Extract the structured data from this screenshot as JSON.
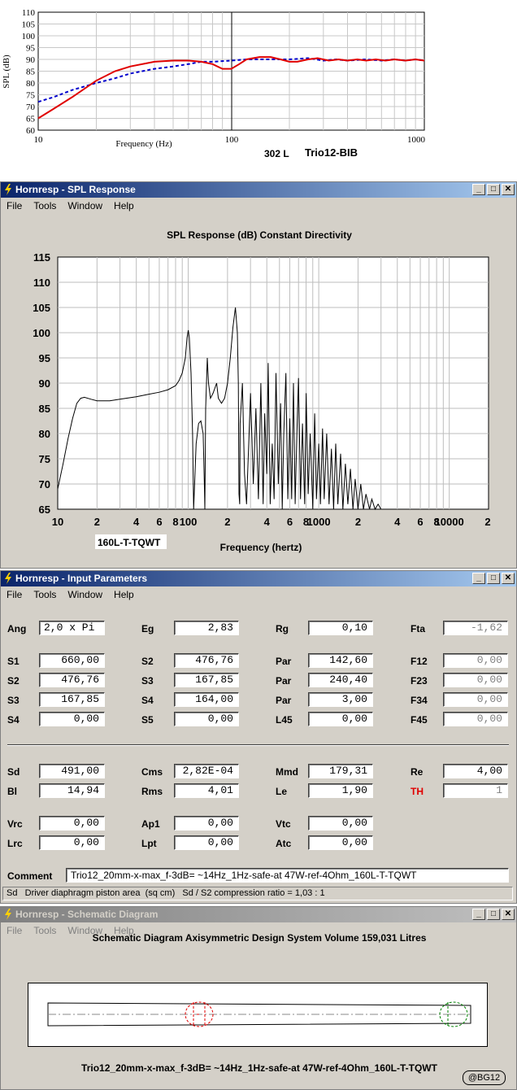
{
  "top_chart": {
    "ylabel": "SPL (dB)",
    "xlabel": "Frequency (Hz)",
    "y_ticks": [
      "110",
      "105",
      "100",
      "95",
      "90",
      "85",
      "80",
      "75",
      "70",
      "65",
      "60"
    ],
    "x_ticks": [
      "10",
      "100",
      "1000"
    ],
    "volume": "302 L",
    "name": "Trio12-BIB"
  },
  "spl_window": {
    "title": "Hornresp - SPL Response",
    "menu": [
      "File",
      "Tools",
      "Window",
      "Help"
    ],
    "heading": "SPL Response (dB)   Constant Directivity",
    "y_ticks": [
      "115",
      "110",
      "105",
      "100",
      "95",
      "90",
      "85",
      "80",
      "75",
      "70",
      "65"
    ],
    "x_ticks": [
      "10",
      "2",
      "4",
      "6",
      "8",
      "100",
      "2",
      "4",
      "6",
      "8",
      "1000",
      "2",
      "4",
      "6",
      "8",
      "10000",
      "2"
    ],
    "legend": "160L-T-TQWT",
    "xlabel": "Frequency (hertz)"
  },
  "input_window": {
    "title": "Hornresp - Input Parameters",
    "menu": [
      "File",
      "Tools",
      "Window",
      "Help"
    ],
    "params": {
      "Ang": "2,0 x Pi",
      "Eg": "2,83",
      "Rg": "0,10",
      "Fta": "-1,62",
      "S1": "660,00",
      "S2a": "476,76",
      "Par1": "142,60",
      "F12": "0,00",
      "S2b": "476,76",
      "S3a": "167,85",
      "Par2": "240,40",
      "F23": "0,00",
      "S3b": "167,85",
      "S4a": "164,00",
      "Par3": "3,00",
      "F34": "0,00",
      "S4b": "0,00",
      "S5": "0,00",
      "L45": "0,00",
      "F45": "0,00",
      "Sd": "491,00",
      "Cms": "2,82E-04",
      "Mmd": "179,31",
      "Re": "4,00",
      "Bl": "14,94",
      "Rms": "4,01",
      "Le": "1,90",
      "TH": "1",
      "Vrc": "0,00",
      "Ap1": "0,00",
      "Vtc": "0,00",
      "Lrc": "0,00",
      "Lpt": "0,00",
      "Atc": "0,00"
    },
    "labels": {
      "Ang": "Ang",
      "Eg": "Eg",
      "Rg": "Rg",
      "Fta": "Fta",
      "S1": "S1",
      "S2": "S2",
      "Par": "Par",
      "F12": "F12",
      "S3": "S3",
      "F23": "F23",
      "S4": "S4",
      "F34": "F34",
      "S5": "S5",
      "L45": "L45",
      "F45": "F45",
      "Sd": "Sd",
      "Cms": "Cms",
      "Mmd": "Mmd",
      "Re": "Re",
      "Bl": "Bl",
      "Rms": "Rms",
      "Le": "Le",
      "TH": "TH",
      "Vrc": "Vrc",
      "Ap1": "Ap1",
      "Vtc": "Vtc",
      "Lrc": "Lrc",
      "Lpt": "Lpt",
      "Atc": "Atc"
    },
    "comment_label": "Comment",
    "comment": "Trio12_20mm-x-max_f-3dB= ~14Hz_1Hz-safe-at 47W-ref-4Ohm_160L-T-TQWT",
    "status": "Sd   Driver diaphragm piston area  (sq cm)   Sd / S2 compression ratio = 1,03 : 1"
  },
  "schematic_window": {
    "title": "Hornresp - Schematic Diagram",
    "menu": [
      "File",
      "Tools",
      "Window",
      "Help"
    ],
    "heading": "Schematic Diagram   Axisymmetric Design   System Volume 159,031 Litres",
    "caption": "Trio12_20mm-x-max_f-3dB= ~14Hz_1Hz-safe-at 47W-ref-4Ohm_160L-T-TQWT",
    "badge": "@BG12"
  },
  "colors": {
    "title_active": "#0a246a",
    "curve_red": "#e00000",
    "curve_blue": "#0000cc",
    "param_red": "#e00000"
  }
}
